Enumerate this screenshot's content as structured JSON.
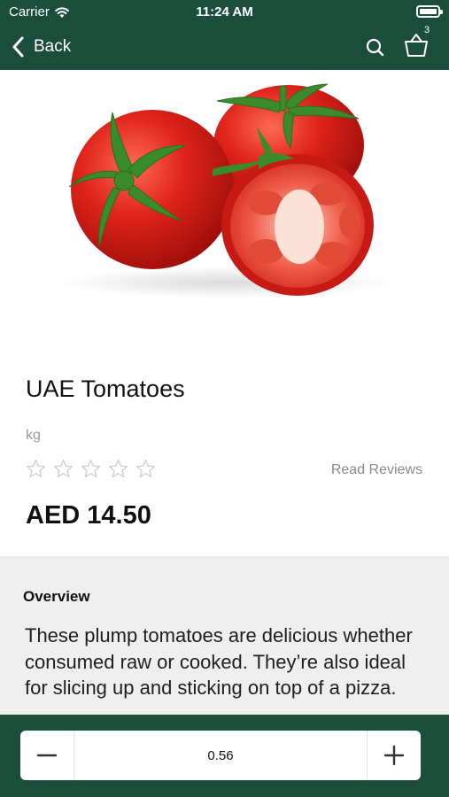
{
  "status_bar": {
    "carrier": "Carrier",
    "time": "11:24 AM",
    "battery_icon": "battery-full-icon",
    "wifi_icon": "wifi-icon"
  },
  "nav": {
    "back_label": "Back",
    "back_icon": "chevron-left-icon",
    "search_icon": "search-icon",
    "cart_icon": "basket-icon",
    "cart_count": "3"
  },
  "product": {
    "image": "tomatoes-photo",
    "name": "UAE Tomatoes",
    "unit": "kg",
    "rating": 0,
    "rating_max": 5,
    "reviews_link": "Read Reviews",
    "price": "AED 14.50"
  },
  "overview": {
    "heading": "Overview",
    "text": "These plump tomatoes are delicious whether consumed raw or cooked. They’re also ideal for slicing up and sticking on top of a pizza."
  },
  "quantity": {
    "value": "0.56",
    "minus_icon": "minus-icon",
    "plus_icon": "plus-icon"
  },
  "colors": {
    "brand_green": "#1b4d3b",
    "tomato_red": "#d8231f"
  }
}
